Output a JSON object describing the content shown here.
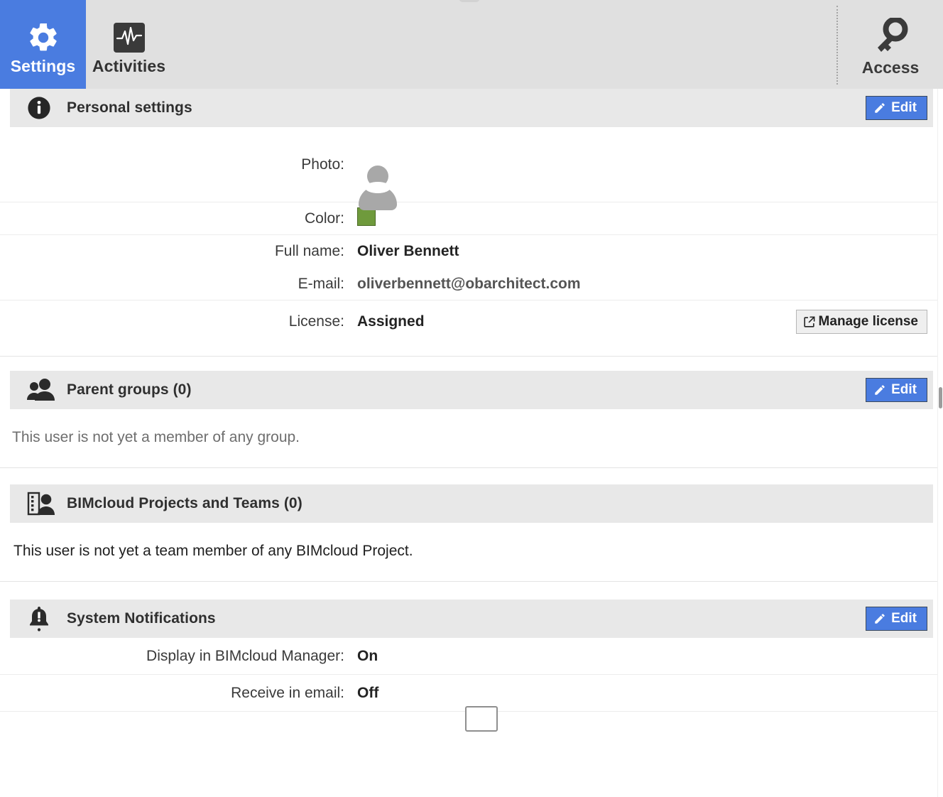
{
  "tabs": [
    {
      "id": "settings",
      "label": "Settings",
      "icon": "gear-icon",
      "active": true
    },
    {
      "id": "activities",
      "label": "Activities",
      "icon": "activity-monitor-icon",
      "active": false
    }
  ],
  "right_tab": {
    "id": "access",
    "label": "Access",
    "icon": "key-icon"
  },
  "sections": {
    "personal": {
      "title": "Personal settings",
      "icon": "info-icon",
      "edit_label": "Edit",
      "rows": {
        "photo": {
          "label": "Photo:",
          "value": ""
        },
        "color": {
          "label": "Color:",
          "value": "#6f9a3c"
        },
        "full_name": {
          "label": "Full name:",
          "value": "Oliver Bennett"
        },
        "email": {
          "label": "E-mail:",
          "value": "oliverbennett@obarchitect.com"
        },
        "license": {
          "label": "License:",
          "value": "Assigned",
          "button_label": "Manage license"
        }
      }
    },
    "parent_groups": {
      "title": "Parent groups",
      "count": "(0)",
      "icon": "people-icon",
      "edit_label": "Edit",
      "empty_text": "This user is not yet a member of any group."
    },
    "projects_teams": {
      "title": "BIMcloud Projects and Teams",
      "count": "(0)",
      "icon": "building-person-icon",
      "empty_text": "This user is not yet a team member of any BIMcloud Project."
    },
    "system_notifications": {
      "title": "System Notifications",
      "icon": "bell-alert-icon",
      "edit_label": "Edit",
      "rows": {
        "display": {
          "label": "Display in BIMcloud Manager:",
          "value": "On"
        },
        "email": {
          "label": "Receive in email:",
          "value": "Off"
        }
      }
    }
  },
  "colors": {
    "accent": "#4a7ce0",
    "tabbar_bg": "#e0e0e0",
    "section_header_bg": "#e8e8e8",
    "swatch": "#6f9a3c",
    "icon_dark": "#333333"
  }
}
